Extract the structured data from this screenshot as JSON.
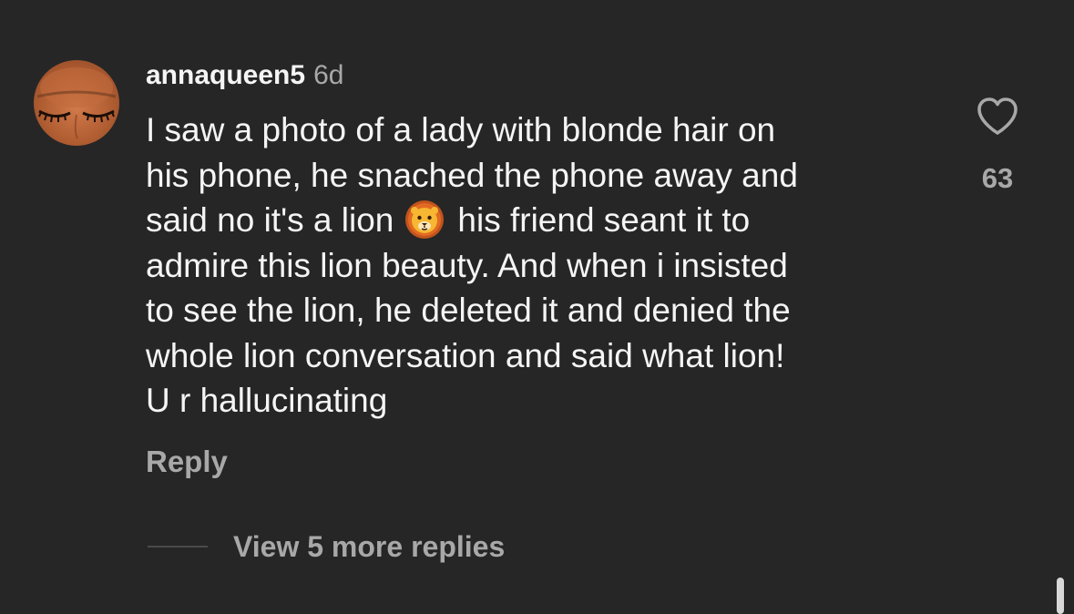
{
  "comment": {
    "username": "annaqueen5",
    "timestamp": "6d",
    "avatar_icon": "profile-photo-closed-eyes",
    "lines": [
      "I saw a photo of a lady with blonde hair on",
      "his phone, he snached the phone away and",
      "said no it's a lion",
      "his friend seant it to",
      "admire this lion beauty. And when i insisted",
      "to see the lion, he deleted it and denied the",
      "whole lion conversation and said what lion!",
      "U r hallucinating"
    ],
    "emoji": "lion-face-emoji",
    "reply_label": "Reply",
    "like_icon": "heart-outline-icon",
    "like_count": "63"
  },
  "replies": {
    "view_more_label": "View 5 more replies"
  },
  "colors": {
    "background": "#262626",
    "primary_text": "#f5f5f5",
    "secondary_text": "#a8a8a8"
  }
}
